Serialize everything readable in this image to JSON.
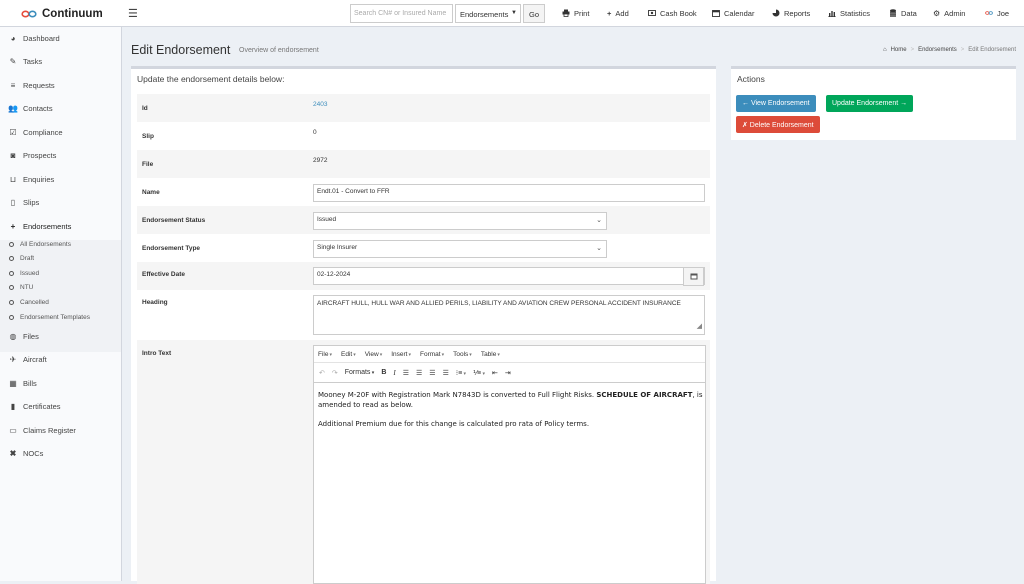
{
  "brand": {
    "name": "Continuum"
  },
  "topbar": {
    "search_placeholder": "Search CN# or Insured Name",
    "search_select": "Endorsements",
    "go_label": "Go",
    "nav": [
      {
        "label": "Print",
        "icon": "print-icon"
      },
      {
        "label": "Add",
        "icon": "plus-icon"
      },
      {
        "label": "Cash Book",
        "icon": "money-icon"
      },
      {
        "label": "Calendar",
        "icon": "calendar-icon"
      },
      {
        "label": "Reports",
        "icon": "pie-chart-icon"
      },
      {
        "label": "Statistics",
        "icon": "bar-chart-icon"
      },
      {
        "label": "Data",
        "icon": "database-icon"
      },
      {
        "label": "Admin",
        "icon": "cogs-icon"
      },
      {
        "label": "Joe",
        "icon": "user-logo-icon"
      }
    ]
  },
  "sidebar": {
    "items": [
      {
        "label": "Dashboard",
        "icon": "dashboard-icon"
      },
      {
        "label": "Tasks",
        "icon": "pencil-icon"
      },
      {
        "label": "Requests",
        "icon": "list-icon"
      },
      {
        "label": "Contacts",
        "icon": "users-icon"
      },
      {
        "label": "Compliance",
        "icon": "check-square-icon"
      },
      {
        "label": "Prospects",
        "icon": "binoculars-icon"
      },
      {
        "label": "Enquiries",
        "icon": "inbox-icon"
      },
      {
        "label": "Slips",
        "icon": "file-icon"
      },
      {
        "label": "Endorsements",
        "icon": "plus-icon"
      },
      {
        "label": "Files",
        "icon": "globe-icon"
      },
      {
        "label": "Aircraft",
        "icon": "plane-icon"
      },
      {
        "label": "Bills",
        "icon": "calculator-icon"
      },
      {
        "label": "Certificates",
        "icon": "bookmark-icon"
      },
      {
        "label": "Claims Register",
        "icon": "car-icon"
      },
      {
        "label": "NOCs",
        "icon": "close-icon"
      }
    ],
    "sub_items": [
      "All Endorsements",
      "Draft",
      "Issued",
      "NTU",
      "Cancelled",
      "Endorsement Templates"
    ]
  },
  "page": {
    "title": "Edit Endorsement",
    "subtitle": "Overview of endorsement",
    "breadcrumb": {
      "home": "Home",
      "section": "Endorsements",
      "current": "Edit Endorsement"
    }
  },
  "form": {
    "header": "Update the endorsement details below:",
    "id_label": "Id",
    "id_value": "2403",
    "slip_label": "Slip",
    "slip_value": "0",
    "file_label": "File",
    "file_value": "2972",
    "name_label": "Name",
    "name_value": "Endt.01 - Convert to FFR",
    "status_label": "Endorsement Status",
    "status_value": "Issued",
    "type_label": "Endorsement Type",
    "type_value": "Single Insurer",
    "date_label": "Effective Date",
    "date_value": "02-12-2024",
    "heading_label": "Heading",
    "heading_value": "AIRCRAFT HULL, HULL WAR AND ALLIED PERILS, LIABILITY AND AVIATION CREW PERSONAL ACCIDENT INSURANCE",
    "intro_label": "Intro Text"
  },
  "editor": {
    "menus": [
      "File",
      "Edit",
      "View",
      "Insert",
      "Format",
      "Tools",
      "Table"
    ],
    "formats_label": "Formats",
    "p1_pre": "Mooney M-20F with Registration Mark N7843D is converted to Full Flight Risks. ",
    "p1_bold": "SCHEDULE OF AIRCRAFT",
    "p1_post": ", is amended to read as below.",
    "p2": "Additional Premium due for this change is calculated pro rata of Policy terms."
  },
  "actions": {
    "title": "Actions",
    "view_label": "← View Endorsement",
    "update_label": "Update Endorsement →",
    "delete_label": "✗ Delete Endorsement",
    "colors": {
      "view": "#3c8dbc",
      "update": "#00a65a",
      "delete": "#dd4b39"
    }
  }
}
